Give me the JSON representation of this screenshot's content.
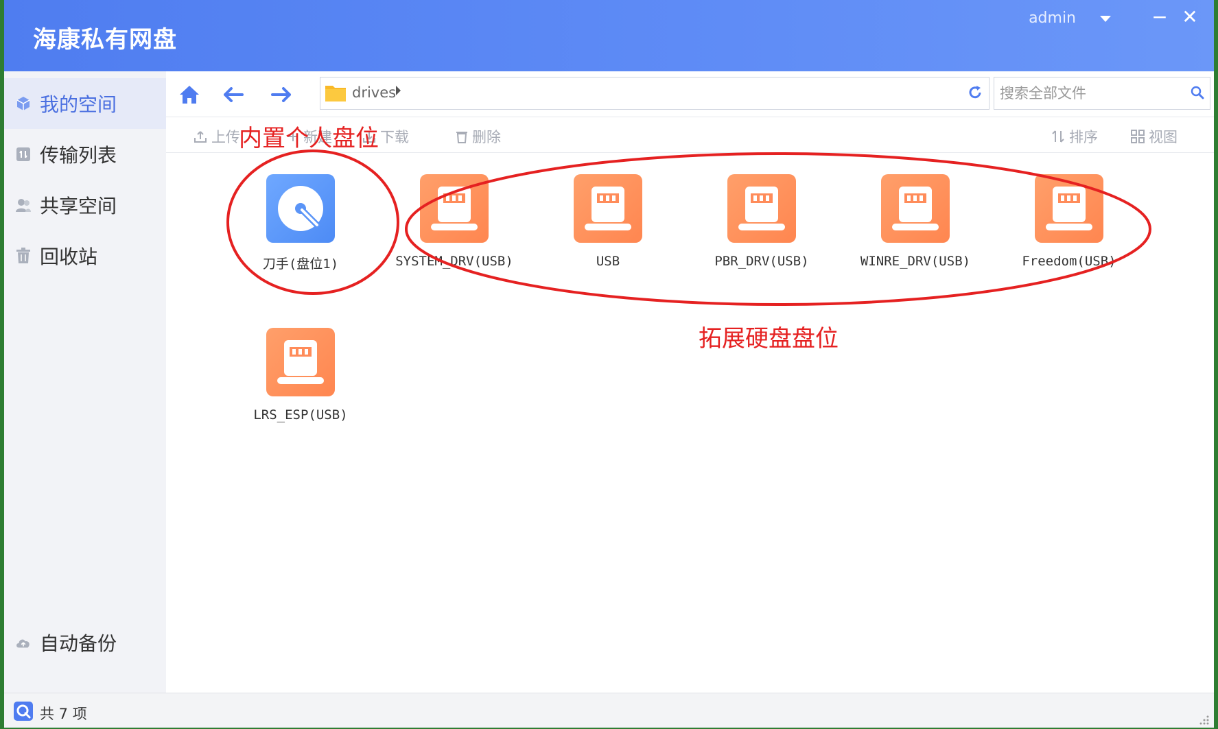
{
  "app": {
    "title": "海康私有网盘",
    "user": "admin",
    "minimize": "−",
    "close": "✕"
  },
  "sidebar": {
    "items": [
      {
        "label": "我的空间"
      },
      {
        "label": "传输列表"
      },
      {
        "label": "共享空间"
      },
      {
        "label": "回收站"
      }
    ],
    "bottom_item": {
      "label": "自动备份"
    }
  },
  "nav": {
    "path": "drives",
    "search_placeholder": "搜索全部文件"
  },
  "toolbar": {
    "upload": "上传",
    "new": "新建",
    "download": "下载",
    "delete": "删除",
    "sort": "排序",
    "view": "视图"
  },
  "files": [
    {
      "name": "刀手(盘位1)",
      "type": "internal"
    },
    {
      "name": "SYSTEM_DRV(USB)",
      "type": "usb"
    },
    {
      "name": "USB",
      "type": "usb"
    },
    {
      "name": "PBR_DRV(USB)",
      "type": "usb"
    },
    {
      "name": "WINRE_DRV(USB)",
      "type": "usb"
    },
    {
      "name": "Freedom(USB)",
      "type": "usb"
    },
    {
      "name": "LRS_ESP(USB)",
      "type": "usb"
    }
  ],
  "annotations": {
    "internal_label": "内置个人盘位",
    "extended_label": "拓展硬盘盘位"
  },
  "status": {
    "count_text": "共 7 项"
  },
  "colors": {
    "accent": "#5b86f3",
    "usb_tile": "#ff8c5a",
    "internal_tile": "#5a94f7",
    "annotation": "#e52121"
  }
}
